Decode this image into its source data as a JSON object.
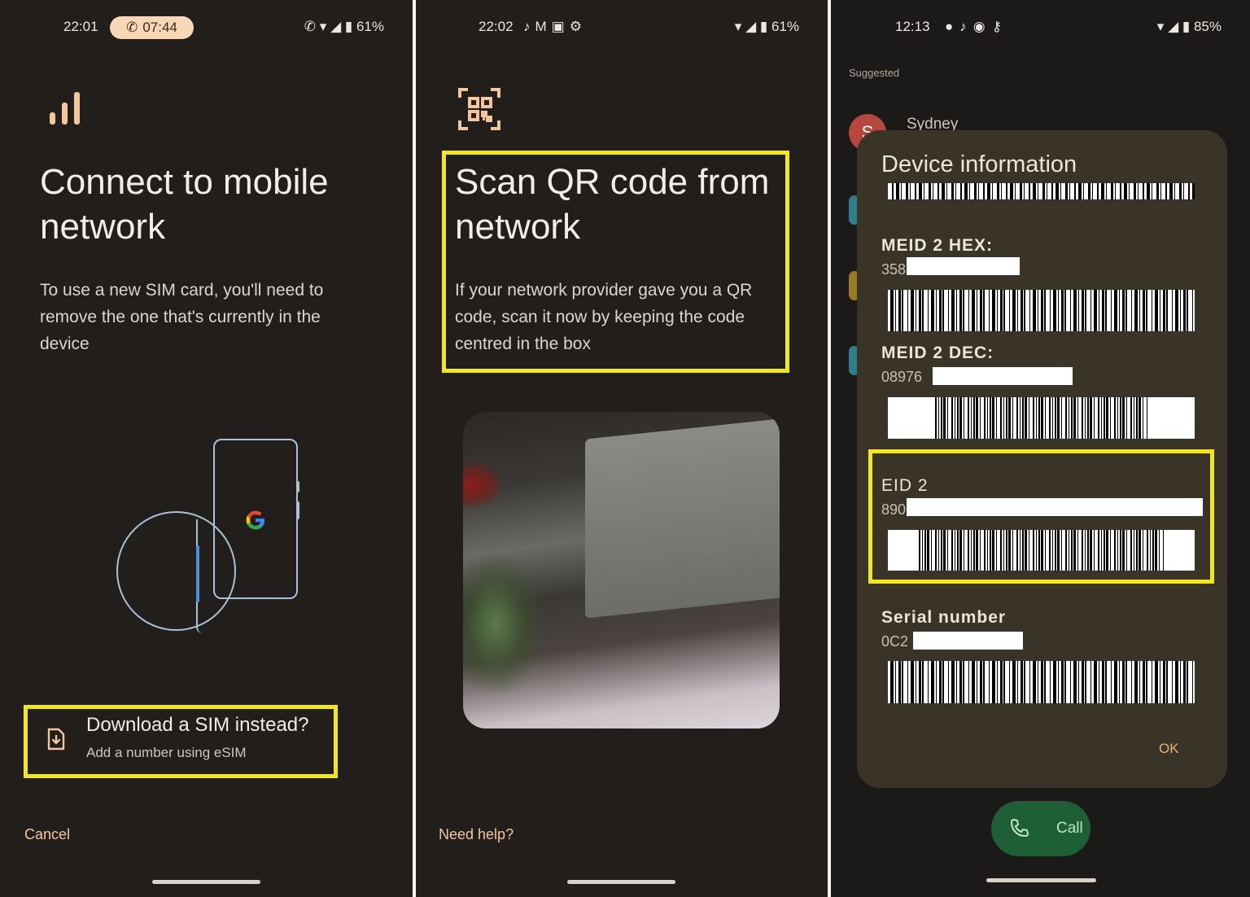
{
  "panel1": {
    "status": {
      "time": "22:01",
      "call_pill_time": "07:44",
      "battery": "61%"
    },
    "title_line1": "Connect to mobile",
    "title_line2": "network",
    "body": "To use a new SIM card, you'll need to remove the one that's currently in the device",
    "download_title": "Download a SIM instead?",
    "download_subtitle": "Add a number using eSIM",
    "cancel_label": "Cancel",
    "icons": {
      "header": "signal-bars-icon",
      "download": "sim-download-icon",
      "logo": "google-logo"
    }
  },
  "panel2": {
    "status": {
      "time": "22:02",
      "battery": "61%"
    },
    "title_line1": "Scan QR code from",
    "title_line2": "network",
    "body": "If your network provider gave you a QR code, scan it now by keeping the code centred in the box",
    "help_label": "Need help?",
    "icons": {
      "header": "qr-code-icon"
    }
  },
  "panel3": {
    "status": {
      "time": "12:13",
      "battery": "85%"
    },
    "suggested_label": "Suggested",
    "contact": {
      "initial": "S",
      "name": "Sydney"
    },
    "dialog": {
      "title": "Device information",
      "fields": [
        {
          "label": "MEID 2 HEX:",
          "value": "358"
        },
        {
          "label": "MEID 2 DEC:",
          "value": "08976"
        },
        {
          "label": "EID 2",
          "value": "890"
        },
        {
          "label": "Serial number",
          "value": "0C2"
        }
      ],
      "ok_label": "OK"
    },
    "call_label": "Call"
  },
  "colors": {
    "highlight": "#f2e61c",
    "background": "#211e1b",
    "accent": "#f3c79c"
  }
}
